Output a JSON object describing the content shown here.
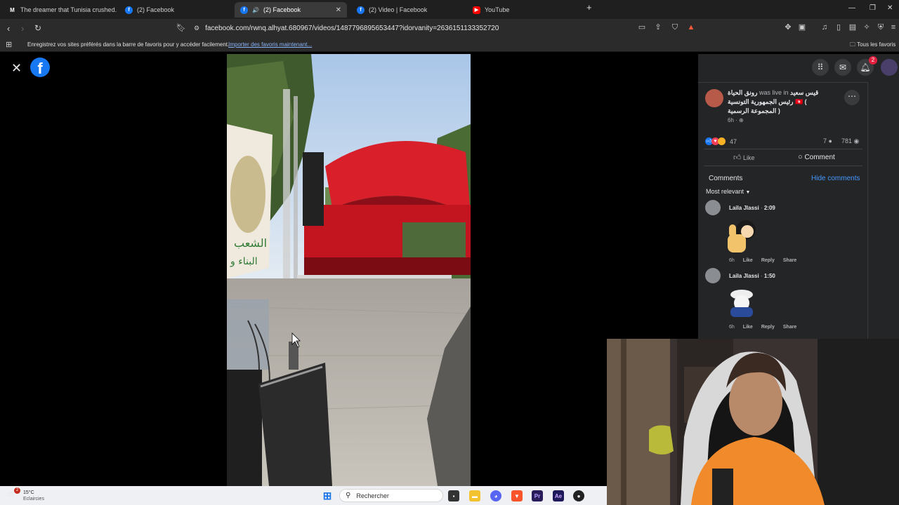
{
  "browser": {
    "tabs": [
      {
        "title": "The dreamer that Tunisia crushed. Th",
        "icon": "medium-icon",
        "active": false
      },
      {
        "title": "(2) Facebook",
        "icon": "facebook-icon",
        "active": false
      },
      {
        "title": "(2) Facebook",
        "icon": "facebook-icon",
        "active": true
      },
      {
        "title": "(2) Video | Facebook",
        "icon": "facebook-icon",
        "active": false
      },
      {
        "title": "YouTube",
        "icon": "youtube-icon",
        "active": false
      }
    ],
    "url": "facebook.com/rwnq.alhyat.680967/videos/1487796895653447?idorvanity=2636151133352720",
    "bookmarks_message": "Enregistrez vos sites préférés dans la barre de favoris pour y accéder facilement.",
    "bookmarks_link": "Importer des favoris maintenant...",
    "all_favorites": "Tous les favoris"
  },
  "facebook": {
    "notification_count": "2",
    "post": {
      "author": "رونق الحياة",
      "was_live_in": "was live in",
      "group": "قيس سعيد رئيس الجمهورية التونسية 🇹🇳 ( المجموعة الرسمية )",
      "time": "6h ·",
      "reactions_count": "47",
      "comments_count": "7",
      "views_count": "781",
      "like_label": "Like",
      "comment_label": "Comment"
    },
    "comments_section": {
      "title": "Comments",
      "hide_label": "Hide comments",
      "sort_label": "Most relevant",
      "items": [
        {
          "author": "Laila Jlassi",
          "timestamp": "2:09",
          "time": "6h",
          "like": "Like",
          "reply": "Reply",
          "share": "Share",
          "sticker": "thumbs-up-sticker"
        },
        {
          "author": "Laila Jlassi",
          "timestamp": "1:50",
          "time": "6h",
          "like": "Like",
          "reply": "Reply",
          "share": "Share",
          "sticker": "salute-sticker"
        }
      ]
    }
  },
  "video": {
    "banner_text_1": "الشعب",
    "banner_text_2": "البناء و"
  },
  "taskbar": {
    "weather_temp": "15°C",
    "weather_desc": "Eclaircies",
    "weather_badge": "2",
    "search_placeholder": "Rechercher"
  },
  "colors": {
    "facebook_blue": "#1877f2",
    "stage_red": "#d81f2a",
    "link_blue": "#4599ff",
    "notification_red": "#e41e3f"
  }
}
